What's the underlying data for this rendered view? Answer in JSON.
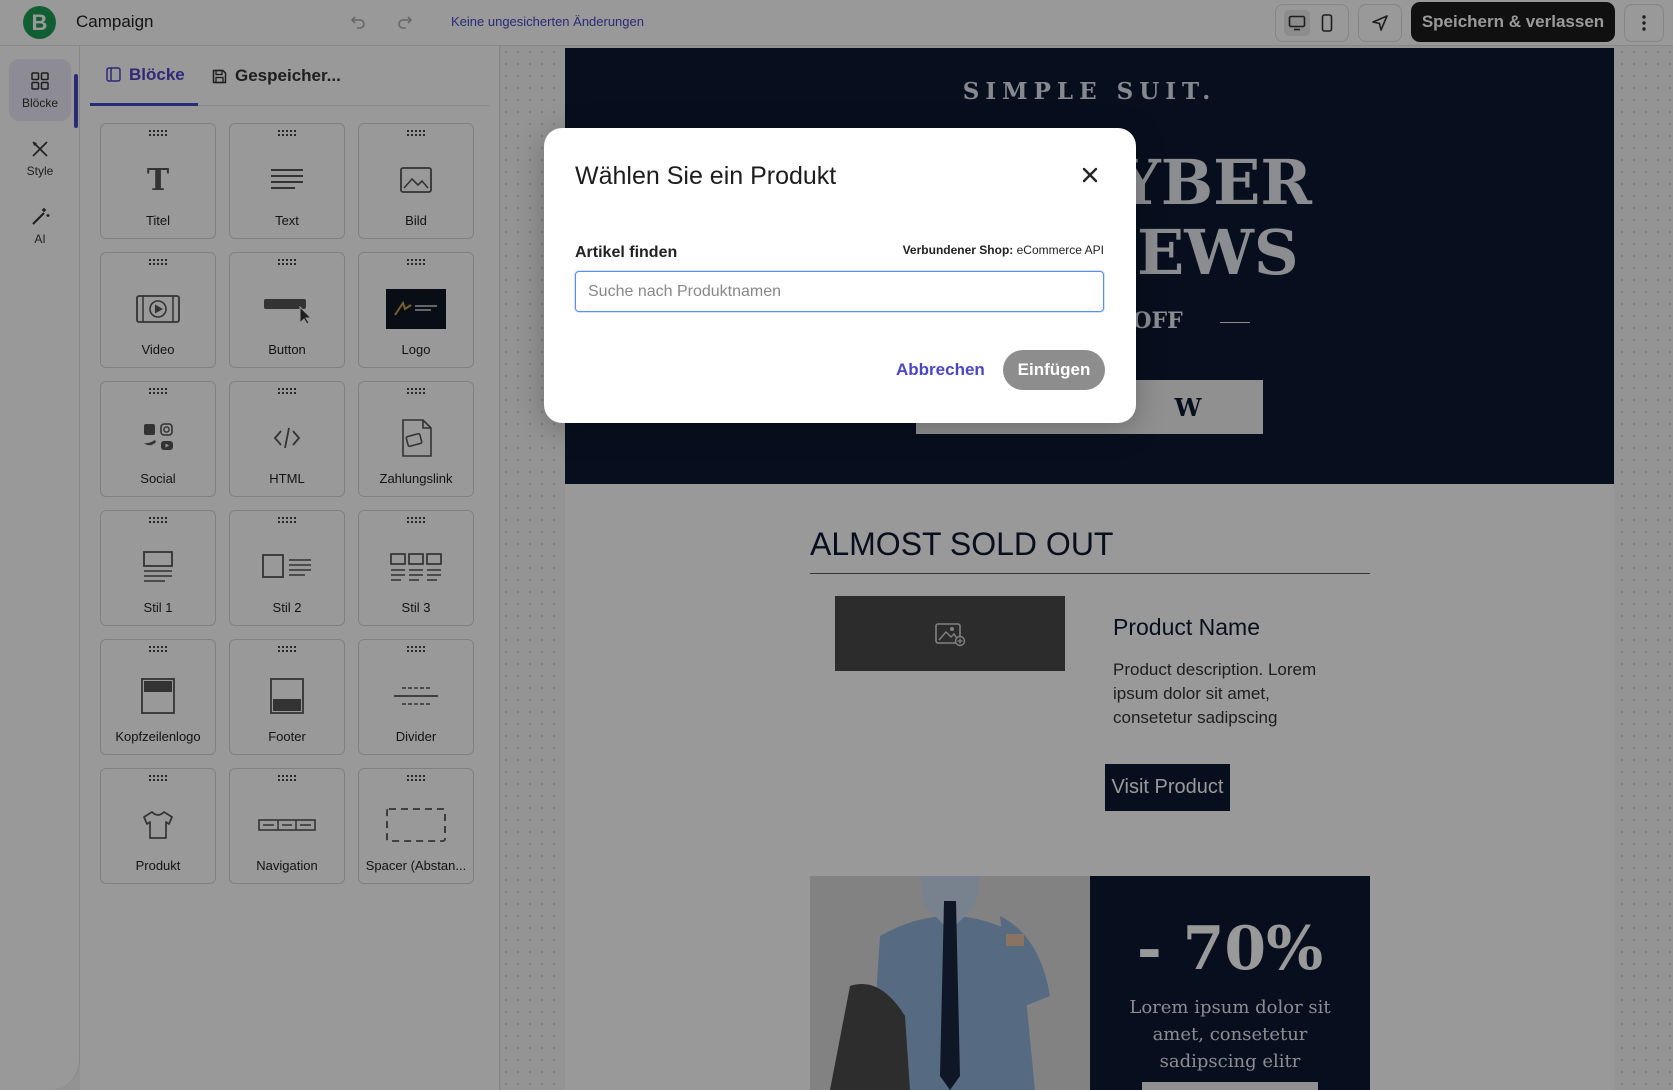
{
  "app": {
    "logo_letter": "B",
    "title": "Campaign",
    "save_status": "Keine ungesicherten Änderungen",
    "save_exit_label": "Speichern & verlassen"
  },
  "rail": [
    {
      "label": "Blöcke",
      "icon": "grid-icon"
    },
    {
      "label": "Style",
      "icon": "brush-icon"
    },
    {
      "label": "AI",
      "icon": "magic-wand-icon"
    }
  ],
  "tabs": {
    "blocks": "Blöcke",
    "saved": "Gespeicher..."
  },
  "blocks": [
    {
      "label": "Titel",
      "icon": "title-icon"
    },
    {
      "label": "Text",
      "icon": "text-icon"
    },
    {
      "label": "Bild",
      "icon": "image-icon"
    },
    {
      "label": "Video",
      "icon": "video-icon"
    },
    {
      "label": "Button",
      "icon": "button-icon"
    },
    {
      "label": "Logo",
      "icon": "logo-thumbnail"
    },
    {
      "label": "Social",
      "icon": "social-icons"
    },
    {
      "label": "HTML",
      "icon": "code-icon"
    },
    {
      "label": "Zahlungslink",
      "icon": "payment-link-icon"
    },
    {
      "label": "Stil 1",
      "icon": "style-1-icon"
    },
    {
      "label": "Stil 2",
      "icon": "style-2-icon"
    },
    {
      "label": "Stil 3",
      "icon": "style-3-icon"
    },
    {
      "label": "Kopfzeilenlogo",
      "icon": "header-logo-icon"
    },
    {
      "label": "Footer",
      "icon": "footer-icon"
    },
    {
      "label": "Divider",
      "icon": "divider-icon"
    },
    {
      "label": "Produkt",
      "icon": "tshirt-icon"
    },
    {
      "label": "Navigation",
      "icon": "navigation-icon"
    },
    {
      "label": "Spacer (Abstan...",
      "icon": "spacer-icon"
    }
  ],
  "email": {
    "brand": "SIMPLE SUIT.",
    "hero_line1": "CYBER",
    "hero_line2": "NEWS",
    "discount": "0% OFF",
    "hero_cta": "W",
    "section_title": "ALMOST SOLD OUT",
    "product_name": "Product Name",
    "product_desc": "Product description. Lorem ipsum dolor sit amet, consetetur sadipscing",
    "visit_label": "Visit Product",
    "promo_pct": "- 70%",
    "promo_text": "Lorem ipsum dolor sit amet, consetetur sadipscing elitr"
  },
  "modal": {
    "title": "Wählen Sie ein Produkt",
    "field_label": "Artikel finden",
    "shop_label": "Verbundener Shop:",
    "shop_value": "eCommerce API",
    "search_placeholder": "Suche nach Produktnamen",
    "search_value": "",
    "cancel_label": "Abbrechen",
    "insert_label": "Einfügen"
  },
  "colors": {
    "accent": "#4a46c8",
    "brand_green": "#1f9d55",
    "email_navy": "#0c1a33",
    "insert_disabled": "#8d8d8d"
  }
}
